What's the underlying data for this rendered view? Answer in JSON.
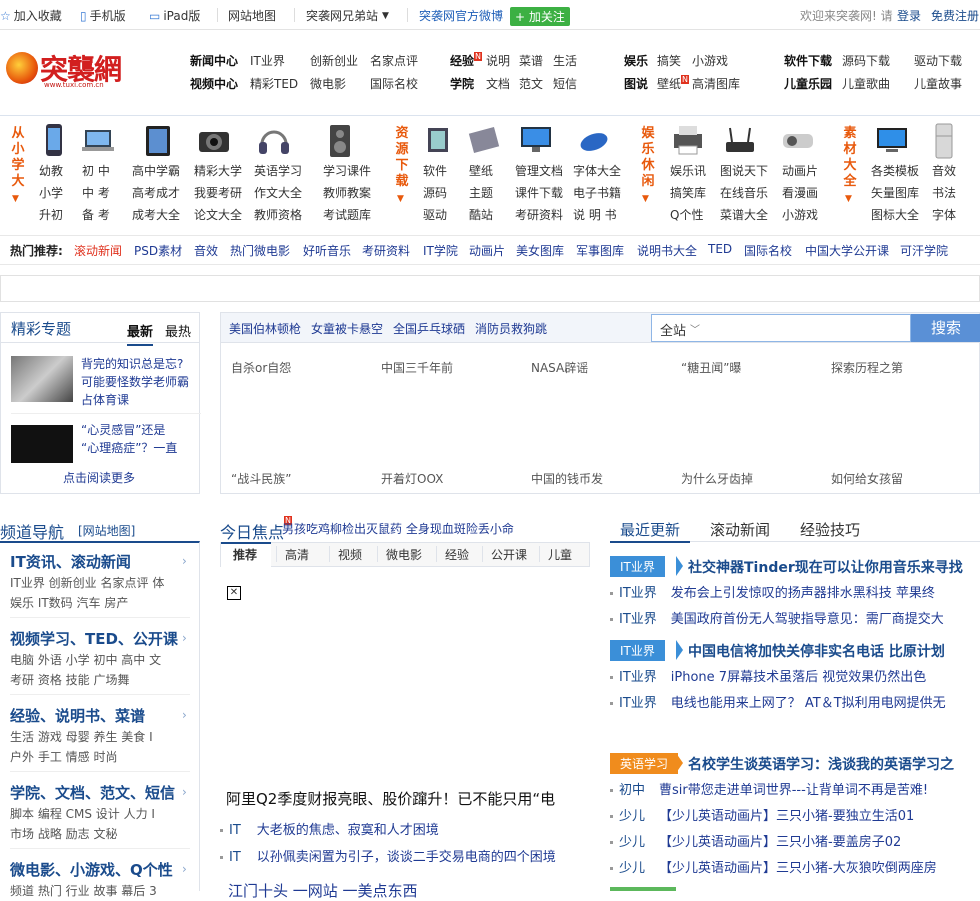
{
  "topbar": {
    "favorite": "加入收藏",
    "mobile": "手机版",
    "ipad": "iPad版",
    "sitemap": "网站地图",
    "brothers": "突袭网兄弟站",
    "weibo": "突袭网官方微博",
    "follow": "+ 加关注",
    "welcome": "欢迎来突袭网! 请",
    "login": "登录",
    "register": "免费注册"
  },
  "logo": {
    "text": "突襲網",
    "url": "www.tuxi.com.cn"
  },
  "header_nav": {
    "row1": [
      {
        "label": "新闻中心",
        "bold": true
      },
      {
        "label": "IT业界"
      },
      {
        "label": "创新创业"
      },
      {
        "label": "名家点评"
      },
      {
        "label": "经验",
        "bold": true,
        "badge": "N"
      },
      {
        "label": "说明"
      },
      {
        "label": "菜谱"
      },
      {
        "label": "生活"
      },
      {
        "label": "娱乐",
        "bold": true
      },
      {
        "label": "搞笑"
      },
      {
        "label": "小游戏"
      },
      {
        "label": "软件下载",
        "bold": true
      },
      {
        "label": "源码下载"
      },
      {
        "label": "驱动下载"
      }
    ],
    "row2": [
      {
        "label": "视频中心",
        "bold": true
      },
      {
        "label": "精彩TED"
      },
      {
        "label": "微电影"
      },
      {
        "label": "国际名校"
      },
      {
        "label": "学院",
        "bold": true
      },
      {
        "label": "文档"
      },
      {
        "label": "范文"
      },
      {
        "label": "短信"
      },
      {
        "label": "图说",
        "bold": true
      },
      {
        "label": "壁纸",
        "badge": "N"
      },
      {
        "label": "高清图库"
      },
      {
        "label": "儿童乐园",
        "bold": true
      },
      {
        "label": "儿童歌曲"
      },
      {
        "label": "儿童故事"
      }
    ]
  },
  "categories": {
    "group1_label": "从小学大",
    "group2_label": "资源下载",
    "group3_label": "娱乐休闲",
    "group4_label": "素材大全",
    "g1c1": [
      "幼教",
      "小学",
      "升初"
    ],
    "g1c2": [
      "初 中",
      "中 考",
      "备 考"
    ],
    "g1c3": [
      "高中学霸",
      "高考成才",
      "成考大全"
    ],
    "g1c4": [
      "精彩大学",
      "我要考研",
      "论文大全"
    ],
    "g1c5": [
      "英语学习",
      "作文大全",
      "教师资格"
    ],
    "g1c6": [
      "学习课件",
      "教师教案",
      "考试题库"
    ],
    "g2c1": [
      "软件",
      "源码",
      "驱动"
    ],
    "g2c2": [
      "壁纸",
      "主题",
      "酷站"
    ],
    "g2c3": [
      "管理文档",
      "课件下载",
      "考研资料"
    ],
    "g2c4": [
      "字体大全",
      "电子书籍",
      "说 明 书"
    ],
    "g3c1": [
      "娱乐讯",
      "搞笑库",
      "Q个性"
    ],
    "g3c2": [
      "图说天下",
      "在线音乐",
      "菜谱大全"
    ],
    "g3c3": [
      "动画片",
      "看漫画",
      "小游戏"
    ],
    "g4c1": [
      "各类模板",
      "矢量图库",
      "图标大全"
    ],
    "g4c2": [
      "音效",
      "书法",
      "字体"
    ]
  },
  "hot": {
    "label": "热门推荐:",
    "items": [
      "滚动新闻",
      "PSD素材",
      "音效",
      "热门微电影",
      "好听音乐",
      "考研资料",
      "IT学院",
      "动画片",
      "美女图库",
      "军事图库",
      "说明书大全",
      "TED",
      "国际名校",
      "中国大学公开课",
      "可汗学院"
    ]
  },
  "special": {
    "title": "精彩专题",
    "tab_latest": "最新",
    "tab_hot": "最热",
    "item1": [
      "背完的知识总是忘?",
      "可能要怪数学老师霸",
      "占体育课"
    ],
    "item2": [
      "“心灵感冒”还是",
      "“心理癌症”？一直"
    ],
    "more": "点击阅读更多"
  },
  "search": {
    "tags": [
      "美国伯林顿枪",
      "女童被卡悬空",
      "全国乒乓球硒",
      "消防员救狗跳"
    ],
    "scope": "全站",
    "button": "搜索",
    "kw_row1": [
      "自杀or自怨",
      "中国三千年前",
      "NASA辟谣",
      "“糖丑闻”曝",
      "探索历程之第"
    ],
    "kw_row2": [
      "“战斗民族”",
      "开着灯OOX",
      "中国的钱币发",
      "为什么牙齿掉",
      "如何给女孩留"
    ]
  },
  "channel_nav": {
    "title": "频道导航",
    "sitemap": "[网站地图]",
    "groups": [
      {
        "title": "IT资讯、滚动新闻",
        "l1": "IT业界  创新创业  名家点评  体",
        "l2": "娱乐  IT数码  汽车  房产"
      },
      {
        "title": "视频学习、TED、公开课",
        "l1": "电脑  外语  小学  初中  高中  文",
        "l2": "考研  资格  技能  广场舞"
      },
      {
        "title": "经验、说明书、菜谱",
        "l1": "生活  游戏  母婴  养生  美食  I",
        "l2": "户外  手工  情感  时尚"
      },
      {
        "title": "学院、文档、范文、短信",
        "l1": "脚本  编程  CMS  设计  人力  I",
        "l2": "市场  战略  励志  文秘"
      },
      {
        "title": "微电影、小游戏、Q个性",
        "l1": "频道  热门  行业  故事  幕后  3"
      }
    ]
  },
  "focus": {
    "title": "今日焦点",
    "badge": "N",
    "headline": "男孩吃鸡柳检出灭鼠药 全身现血斑险丢小命",
    "tabs": [
      "推荐",
      "高清",
      "视频",
      "微电影",
      "经验",
      "公开课",
      "儿童"
    ],
    "big_headline": "阿里Q2季度财报亮眼、股价蹿升！已不能只用“电",
    "items": [
      {
        "cat": "IT",
        "text": "大老板的焦虑、寂寞和人才困境"
      },
      {
        "cat": "IT",
        "text": "以孙佩卖闲置为引子，谈谈二手交易电商的四个困境"
      }
    ],
    "bottom_cut": "江门十头 一网站 一美点东西"
  },
  "updates": {
    "tabs": [
      "最近更新",
      "滚动新闻",
      "经验技巧"
    ],
    "block1_tag": "IT业界",
    "block1_head": "社交神器Tinder现在可以让你用音乐来寻找",
    "block1_items": [
      {
        "cat": "IT业界",
        "text": "发布会上引发惊叹的扬声器排水黑科技 苹果终"
      },
      {
        "cat": "IT业界",
        "text": "美国政府首份无人驾驶指导意见：需厂商提交大"
      }
    ],
    "block2_tag": "IT业界",
    "block2_head": "中国电信将加快关停非实名电话 比原计划",
    "block2_items": [
      {
        "cat": "IT业界",
        "text": "iPhone 7屏幕技术虽落后 视觉效果仍然出色"
      },
      {
        "cat": "IT业界",
        "text": "电线也能用来上网了？ AT＆T拟利用电网提供无"
      }
    ],
    "block3_tag": "英语学习",
    "block3_head": "名校学生谈英语学习：浅谈我的英语学习之",
    "block3_items": [
      {
        "cat": "初中",
        "text": "曹sir带您走进单词世界---让背单词不再是苦难!"
      },
      {
        "cat": "少儿",
        "text": "【少儿英语动画片】三只小猪-要独立生活01"
      },
      {
        "cat": "少儿",
        "text": "【少儿英语动画片】三只小猪-要盖房子02"
      },
      {
        "cat": "少儿",
        "text": "【少儿英语动画片】三只小猪-大灰狼吹倒两座房"
      }
    ]
  }
}
